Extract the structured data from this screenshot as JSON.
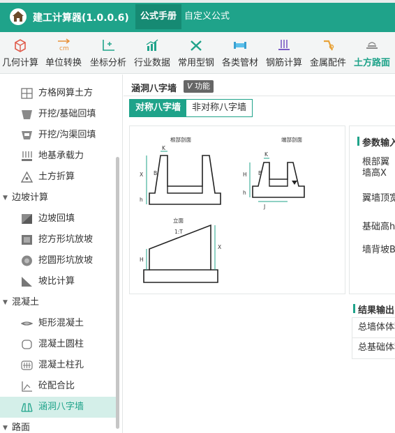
{
  "app": {
    "title": "建工计算器(1.0.0.6)"
  },
  "top_tabs": [
    {
      "label": "公式手册",
      "active": true
    },
    {
      "label": "自定义公式",
      "active": false
    }
  ],
  "toolbar": [
    {
      "label": "几何计算",
      "icon": "cube-icon"
    },
    {
      "label": "单位转换",
      "icon": "unit-convert-icon"
    },
    {
      "label": "坐标分析",
      "icon": "coordinate-icon"
    },
    {
      "label": "行业数据",
      "icon": "bar-chart-icon"
    },
    {
      "label": "常用型钢",
      "icon": "tools-icon"
    },
    {
      "label": "各类管材",
      "icon": "pipe-icon"
    },
    {
      "label": "钢筋计算",
      "icon": "rebar-icon"
    },
    {
      "label": "金属配件",
      "icon": "metal-fitting-icon"
    },
    {
      "label": "土方路面",
      "icon": "road-icon",
      "active": true
    }
  ],
  "sidebar": {
    "items": [
      {
        "label": "方格网算土方",
        "type": "item",
        "icon": "grid-icon"
      },
      {
        "label": "开挖/基础回填",
        "type": "item",
        "icon": "trench-icon"
      },
      {
        "label": "开挖/沟渠回填",
        "type": "item",
        "icon": "channel-icon"
      },
      {
        "label": "地基承载力",
        "type": "item",
        "icon": "foundation-icon"
      },
      {
        "label": "土方折算",
        "type": "item",
        "icon": "triangle-icon"
      },
      {
        "label": "边坡计算",
        "type": "group"
      },
      {
        "label": "边坡回填",
        "type": "item",
        "icon": "slope-icon"
      },
      {
        "label": "挖方形坑放坡",
        "type": "item",
        "icon": "square-pit-icon"
      },
      {
        "label": "挖圆形坑放坡",
        "type": "item",
        "icon": "round-pit-icon"
      },
      {
        "label": "坡比计算",
        "type": "item",
        "icon": "slope-ratio-icon"
      },
      {
        "label": "混凝土",
        "type": "group"
      },
      {
        "label": "矩形混凝土",
        "type": "item",
        "icon": "rect-concrete-icon"
      },
      {
        "label": "混凝土圆柱",
        "type": "item",
        "icon": "cylinder-icon"
      },
      {
        "label": "混凝土柱孔",
        "type": "item",
        "icon": "column-hole-icon"
      },
      {
        "label": "砼配合比",
        "type": "item",
        "icon": "mix-ratio-icon"
      },
      {
        "label": "涵洞八字墙",
        "type": "item",
        "icon": "culvert-icon",
        "active": true
      },
      {
        "label": "路面",
        "type": "group"
      }
    ]
  },
  "main": {
    "title": "涵洞八字墙",
    "badge": "功能",
    "segments": [
      {
        "label": "对称八字墙",
        "active": true
      },
      {
        "label": "非对称八字墙",
        "active": false
      }
    ],
    "diagram": {
      "root_section": "根部剖面",
      "end_section": "端部剖面",
      "elevation": "立面",
      "labels": {
        "K": "K",
        "X": "X",
        "B": "B",
        "h": "h",
        "H": "H",
        "J": "J",
        "ratio": "1:T"
      }
    },
    "params": {
      "title": "参数输入",
      "fields": [
        {
          "label": "根部翼墙高X"
        },
        {
          "label": "翼墙顶宽"
        },
        {
          "label": "基础高h"
        },
        {
          "label": "墙背坡B"
        }
      ]
    },
    "results": {
      "title": "结果输出",
      "rows": [
        {
          "label": "总墙体体积"
        },
        {
          "label": "总基础体积"
        }
      ]
    }
  },
  "colors": {
    "brand": "#1fa38a",
    "brand_dark": "#168a73",
    "accent_icon": "#e8913a"
  }
}
